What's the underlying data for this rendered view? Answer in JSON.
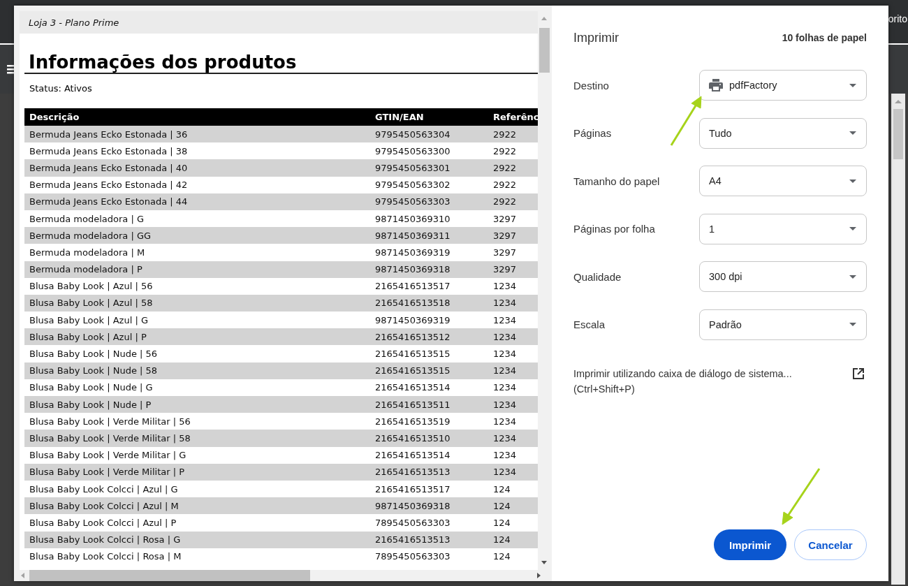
{
  "background": {
    "top_bar_text": "orito"
  },
  "preview": {
    "header": "Loja 3 - Plano Prime",
    "title": "Informações dos produtos",
    "status": "Status: Ativos",
    "table": {
      "columns": [
        "Descrição",
        "GTIN/EAN",
        "Referênc"
      ],
      "rows": [
        [
          "Bermuda Jeans Ecko Estonada | 36",
          "9795450563304",
          "2922"
        ],
        [
          "Bermuda Jeans Ecko Estonada | 38",
          "9795450563300",
          "2922"
        ],
        [
          "Bermuda Jeans Ecko Estonada | 40",
          "9795450563301",
          "2922"
        ],
        [
          "Bermuda Jeans Ecko Estonada | 42",
          "9795450563302",
          "2922"
        ],
        [
          "Bermuda Jeans Ecko Estonada | 44",
          "9795450563303",
          "2922"
        ],
        [
          "Bermuda modeladora | G",
          "9871450369310",
          "3297"
        ],
        [
          "Bermuda modeladora | GG",
          "9871450369311",
          "3297"
        ],
        [
          "Bermuda modeladora | M",
          "9871450369319",
          "3297"
        ],
        [
          "Bermuda modeladora | P",
          "9871450369318",
          "3297"
        ],
        [
          "Blusa Baby Look | Azul | 56",
          "2165416513517",
          "1234"
        ],
        [
          "Blusa Baby Look | Azul | 58",
          "2165416513518",
          "1234"
        ],
        [
          "Blusa Baby Look | Azul | G",
          "9871450369319",
          "1234"
        ],
        [
          "Blusa Baby Look | Azul | P",
          "2165416513512",
          "1234"
        ],
        [
          "Blusa Baby Look | Nude | 56",
          "2165416513515",
          "1234"
        ],
        [
          "Blusa Baby Look | Nude | 58",
          "2165416513515",
          "1234"
        ],
        [
          "Blusa Baby Look | Nude | G",
          "2165416513514",
          "1234"
        ],
        [
          "Blusa Baby Look | Nude | P",
          "2165416513511",
          "1234"
        ],
        [
          "Blusa Baby Look | Verde Militar | 56",
          "2165416513519",
          "1234"
        ],
        [
          "Blusa Baby Look | Verde Militar | 58",
          "2165416513510",
          "1234"
        ],
        [
          "Blusa Baby Look | Verde Militar | G",
          "2165416513514",
          "1234"
        ],
        [
          "Blusa Baby Look | Verde Militar | P",
          "2165416513513",
          "1234"
        ],
        [
          "Blusa Baby Look Colcci | Azul | G",
          "2165416513517",
          "124"
        ],
        [
          "Blusa Baby Look Colcci | Azul | M",
          "9871450369318",
          "124"
        ],
        [
          "Blusa Baby Look Colcci | Azul | P",
          "7895450563303",
          "124"
        ],
        [
          "Blusa Baby Look Colcci | Rosa | G",
          "2165416513513",
          "124"
        ],
        [
          "Blusa Baby Look Colcci | Rosa | M",
          "7895450563303",
          "124"
        ]
      ]
    }
  },
  "panel": {
    "title": "Imprimir",
    "sheet_count": "10 folhas de papel",
    "settings": [
      {
        "label": "Destino",
        "value": "pdfFactory",
        "kind": "printer"
      },
      {
        "label": "Páginas",
        "value": "Tudo",
        "kind": "plain"
      },
      {
        "label": "Tamanho do papel",
        "value": "A4",
        "kind": "plain"
      },
      {
        "label": "Páginas por folha",
        "value": "1",
        "kind": "plain"
      },
      {
        "label": "Qualidade",
        "value": "300 dpi",
        "kind": "plain"
      },
      {
        "label": "Escala",
        "value": "Padrão",
        "kind": "plain"
      }
    ],
    "system_dialog_link": {
      "text": "Imprimir utilizando caixa de diálogo de sistema...",
      "shortcut": "(Ctrl+Shift+P)"
    },
    "buttons": [
      {
        "label": "Imprimir",
        "kind": "primary"
      },
      {
        "label": "Cancelar",
        "kind": "secondary"
      }
    ]
  }
}
